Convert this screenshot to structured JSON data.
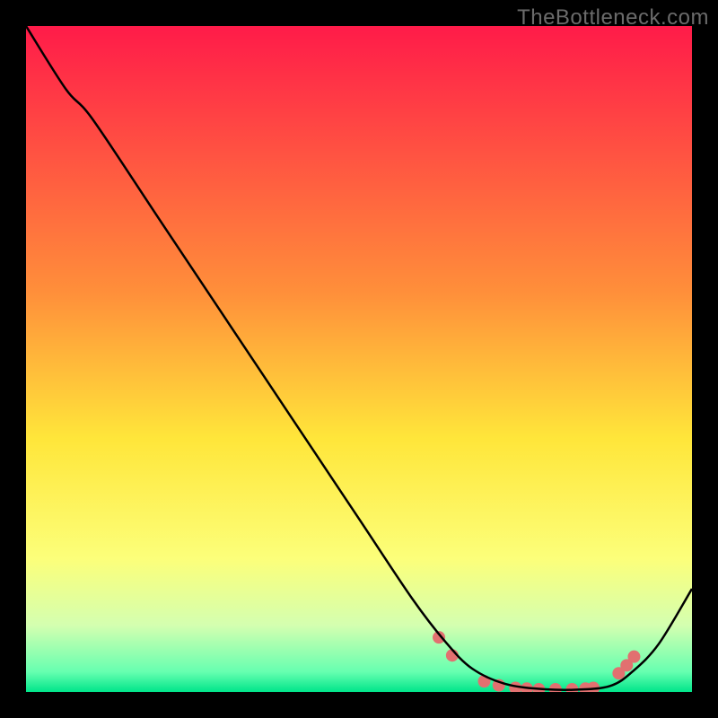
{
  "watermark": {
    "text": "TheBottleneck.com"
  },
  "chart_data": {
    "type": "line",
    "title": "",
    "xlabel": "",
    "ylabel": "",
    "xlim": [
      0,
      1
    ],
    "ylim": [
      0,
      1
    ],
    "grid": false,
    "legend": false,
    "background_gradient": {
      "stops": [
        {
          "offset": 0.0,
          "color": "#ff1b49"
        },
        {
          "offset": 0.4,
          "color": "#ff8f3a"
        },
        {
          "offset": 0.62,
          "color": "#ffe63a"
        },
        {
          "offset": 0.8,
          "color": "#fcff7a"
        },
        {
          "offset": 0.9,
          "color": "#d4ffb0"
        },
        {
          "offset": 0.97,
          "color": "#66ffb0"
        },
        {
          "offset": 1.0,
          "color": "#00e58a"
        }
      ]
    },
    "series": [
      {
        "name": "curve",
        "color": "#000000",
        "stroke_width": 2.5,
        "x": [
          0.0,
          0.06,
          0.1,
          0.2,
          0.3,
          0.4,
          0.5,
          0.58,
          0.63,
          0.67,
          0.72,
          0.78,
          0.84,
          0.88,
          0.91,
          0.95,
          1.0
        ],
        "y": [
          1.0,
          0.905,
          0.86,
          0.71,
          0.56,
          0.41,
          0.26,
          0.14,
          0.075,
          0.035,
          0.012,
          0.004,
          0.004,
          0.01,
          0.03,
          0.072,
          0.155
        ]
      }
    ],
    "markers": {
      "color": "#e27070",
      "radius": 7,
      "points": [
        {
          "x": 0.62,
          "y": 0.082
        },
        {
          "x": 0.64,
          "y": 0.055
        },
        {
          "x": 0.688,
          "y": 0.016
        },
        {
          "x": 0.71,
          "y": 0.01
        },
        {
          "x": 0.735,
          "y": 0.006
        },
        {
          "x": 0.752,
          "y": 0.005
        },
        {
          "x": 0.77,
          "y": 0.004
        },
        {
          "x": 0.795,
          "y": 0.004
        },
        {
          "x": 0.82,
          "y": 0.004
        },
        {
          "x": 0.84,
          "y": 0.005
        },
        {
          "x": 0.852,
          "y": 0.006
        },
        {
          "x": 0.89,
          "y": 0.028
        },
        {
          "x": 0.902,
          "y": 0.04
        },
        {
          "x": 0.913,
          "y": 0.053
        }
      ]
    }
  }
}
